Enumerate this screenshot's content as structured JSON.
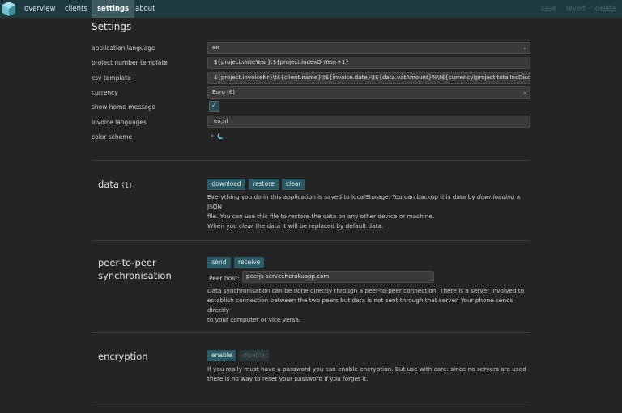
{
  "nav": {
    "items": [
      "overview",
      "clients",
      "settings",
      "about"
    ],
    "actions": [
      "save",
      "revert",
      "delete"
    ]
  },
  "page": {
    "title": "Settings"
  },
  "settings": {
    "rows": [
      {
        "label": "application language",
        "value": "en"
      },
      {
        "label": "project number template",
        "value": "${project.dateYear}.${project.indexOnYear+1}"
      },
      {
        "label": "csv template",
        "value": "${project.invoiceNr}\\t${client.name}\\t${invoice.date}\\t${data.vatAmount}%\\t${currency(project.totalIncDisc"
      },
      {
        "label": "currency",
        "value": "Euro (€)"
      },
      {
        "label": "show home message",
        "value": "✓"
      },
      {
        "label": "invoice languages",
        "value": "en,nl"
      },
      {
        "label": "color scheme",
        "value": ""
      }
    ]
  },
  "data_section": {
    "title": "data",
    "count": "(1)",
    "buttons": [
      "download",
      "restore",
      "clear"
    ],
    "desc": [
      [
        "Everything you do in this application is saved to localStorage. You can backup this data by ",
        "downloading",
        " a JSON"
      ],
      [
        "file. You can use this file to ",
        "restore",
        " the data on any other device or machine."
      ],
      [
        "When you ",
        "clear",
        " the data it will be replaced by default data."
      ]
    ]
  },
  "p2p_section": {
    "title_line1": "peer-to-peer",
    "title_line2": "synchronisation",
    "buttons": [
      "send",
      "receive"
    ],
    "peer_host_label": "Peer host:",
    "peer_host_value": "peerjs-server.herokuapp.com",
    "desc": [
      "Data synchronisation can be done directly through a peer-to-peer connection. There is a server involved to",
      "establish connection between the two peers but data is not sent through that server. Your phone sends directly",
      "to your computer or vice versa."
    ]
  },
  "encryption_section": {
    "title": "encryption",
    "buttons": [
      "enable",
      "disable"
    ],
    "desc": [
      "If you really must have a password you can enable encryption. But use with care: since no servers are used",
      "there is no way to reset your password if you forget it."
    ]
  },
  "colors": {
    "nav_bg": "#1e3a40",
    "button_bg": "#2a5a66",
    "page_bg": "#242424"
  }
}
